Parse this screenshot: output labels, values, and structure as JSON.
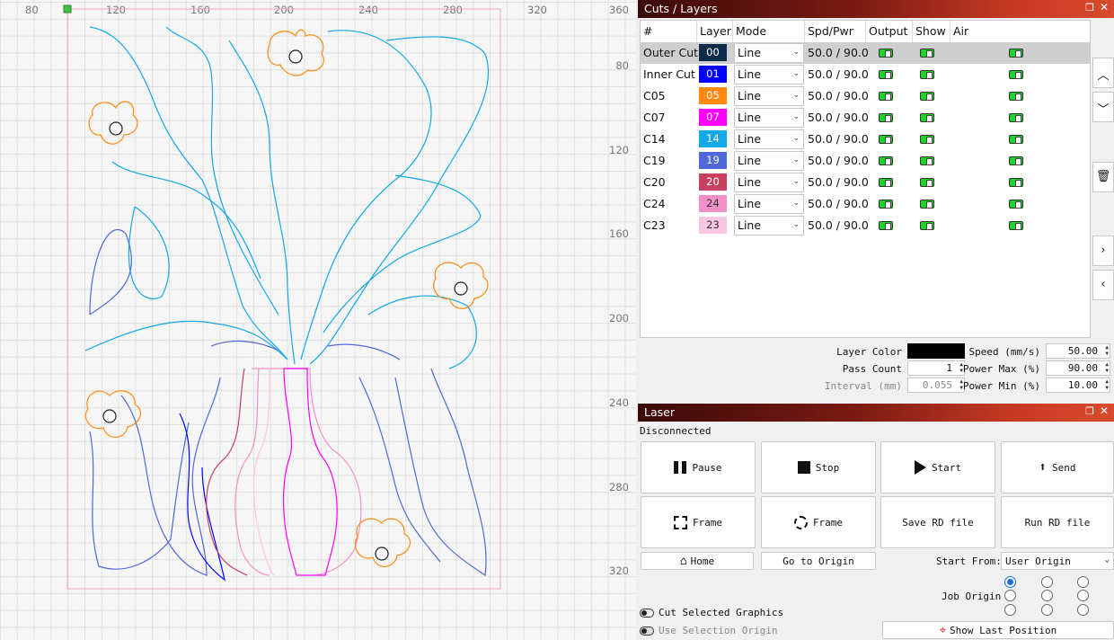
{
  "ruler": {
    "x_ticks": [
      "80",
      "120",
      "160",
      "200",
      "240",
      "280",
      "320"
    ],
    "y_ticks": [
      "360",
      "80",
      "120",
      "160",
      "200",
      "240",
      "280",
      "320"
    ]
  },
  "cuts_panel": {
    "title": "Cuts / Layers",
    "columns": [
      "#",
      "Layer",
      "Mode",
      "Spd/Pwr",
      "Output",
      "Show",
      "Air"
    ],
    "rows": [
      {
        "name": "Outer Cut",
        "layer": "00",
        "color": "#0c2a4a",
        "text_color": "#ffffff",
        "mode": "Line",
        "spdpwr": "50.0 / 90.0",
        "selected": true
      },
      {
        "name": "Inner Cut",
        "layer": "01",
        "color": "#0000ff",
        "text_color": "#ffffff",
        "mode": "Line",
        "spdpwr": "50.0 / 90.0",
        "selected": false
      },
      {
        "name": "C05",
        "layer": "05",
        "color": "#ff8a10",
        "text_color": "#ffffff",
        "mode": "Line",
        "spdpwr": "50.0 / 90.0",
        "selected": false
      },
      {
        "name": "C07",
        "layer": "07",
        "color": "#ff00ff",
        "text_color": "#ffffff",
        "mode": "Line",
        "spdpwr": "50.0 / 90.0",
        "selected": false
      },
      {
        "name": "C14",
        "layer": "14",
        "color": "#14a8e8",
        "text_color": "#ffffff",
        "mode": "Line",
        "spdpwr": "50.0 / 90.0",
        "selected": false
      },
      {
        "name": "C19",
        "layer": "19",
        "color": "#5068d8",
        "text_color": "#ffffff",
        "mode": "Line",
        "spdpwr": "50.0 / 90.0",
        "selected": false
      },
      {
        "name": "C20",
        "layer": "20",
        "color": "#c84060",
        "text_color": "#ffffff",
        "mode": "Line",
        "spdpwr": "50.0 / 90.0",
        "selected": false
      },
      {
        "name": "C24",
        "layer": "24",
        "color": "#f490c8",
        "text_color": "#333333",
        "mode": "Line",
        "spdpwr": "50.0 / 90.0",
        "selected": false
      },
      {
        "name": "C23",
        "layer": "23",
        "color": "#f8c8e0",
        "text_color": "#333333",
        "mode": "Line",
        "spdpwr": "50.0 / 90.0",
        "selected": false
      }
    ],
    "layer_color_label": "Layer Color",
    "layer_color": "#000000",
    "pass_count_label": "Pass Count",
    "pass_count": "1",
    "interval_label": "Interval (mm)",
    "interval": "0.055",
    "speed_label": "Speed (mm/s)",
    "speed": "50.00",
    "power_max_label": "Power Max (%)",
    "power_max": "90.00",
    "power_min_label": "Power Min (%)",
    "power_min": "10.00"
  },
  "laser_panel": {
    "title": "Laser",
    "status": "Disconnected",
    "pause": "Pause",
    "stop": "Stop",
    "start": "Start",
    "send": "Send",
    "frame1": "Frame",
    "frame2": "Frame",
    "save_rd": "Save RD file",
    "run_rd": "Run RD file",
    "home": "Home",
    "go_origin": "Go to Origin",
    "start_from_label": "Start From:",
    "start_from": "User Origin",
    "job_origin_label": "Job Origin",
    "cut_selected": "Cut Selected Graphics",
    "use_selection": "Use Selection Origin",
    "show_last": "Show Last Position"
  },
  "colors": {
    "accent": "#c83a24",
    "toggle_on": "#1bd42a",
    "radio_on": "#1a6fd6"
  }
}
